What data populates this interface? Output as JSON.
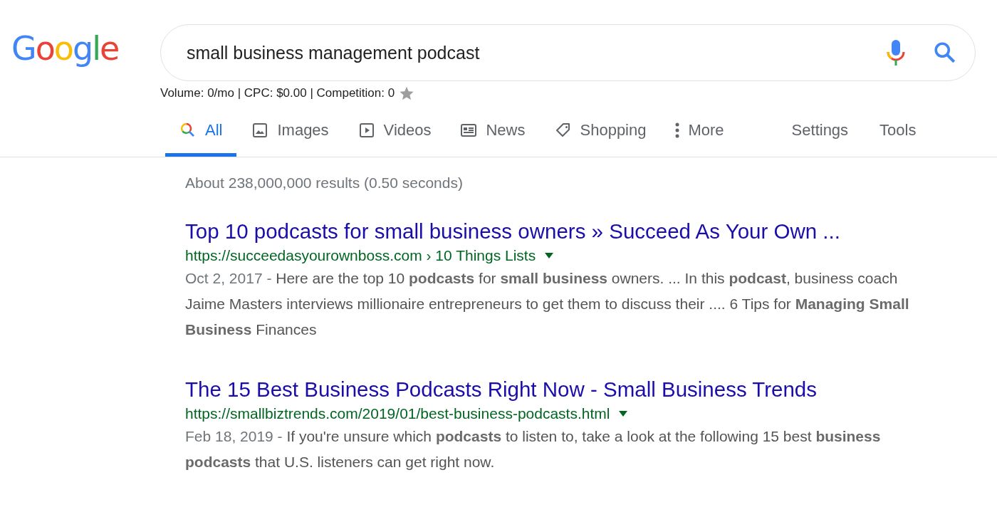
{
  "logo": "Google",
  "search": {
    "value": "small business management podcast"
  },
  "keyword_stats": "Volume: 0/mo | CPC: $0.00 | Competition: 0",
  "tabs": [
    {
      "label": "All",
      "kind": "search",
      "selected": true
    },
    {
      "label": "Images",
      "kind": "image",
      "selected": false
    },
    {
      "label": "Videos",
      "kind": "video",
      "selected": false
    },
    {
      "label": "News",
      "kind": "news",
      "selected": false
    },
    {
      "label": "Shopping",
      "kind": "tag",
      "selected": false
    },
    {
      "label": "More",
      "kind": "dots",
      "selected": false
    }
  ],
  "tools": [
    "Settings",
    "Tools"
  ],
  "result_stats": "About 238,000,000 results (0.50 seconds)",
  "results": [
    {
      "title": "Top 10 podcasts for small business owners » Succeed As Your Own ...",
      "url": "https://succeedasyourownboss.com › 10 Things Lists",
      "date": "Oct 2, 2017 -",
      "snippet": "Here are the top 10 **podcasts** for **small business** owners. ... In this **podcast**, business coach Jaime Masters interviews millionaire entrepreneurs to get them to discuss their .... 6 Tips for **Managing Small Business** Finances"
    },
    {
      "title": "The 15 Best Business Podcasts Right Now - Small Business Trends",
      "url": "https://smallbiztrends.com/2019/01/best-business-podcasts.html",
      "date": "Feb 18, 2019 -",
      "snippet": "If you're unsure which **podcasts** to listen to, take a look at the following 15 best **business podcasts** that U.S. listeners can get right now."
    }
  ]
}
